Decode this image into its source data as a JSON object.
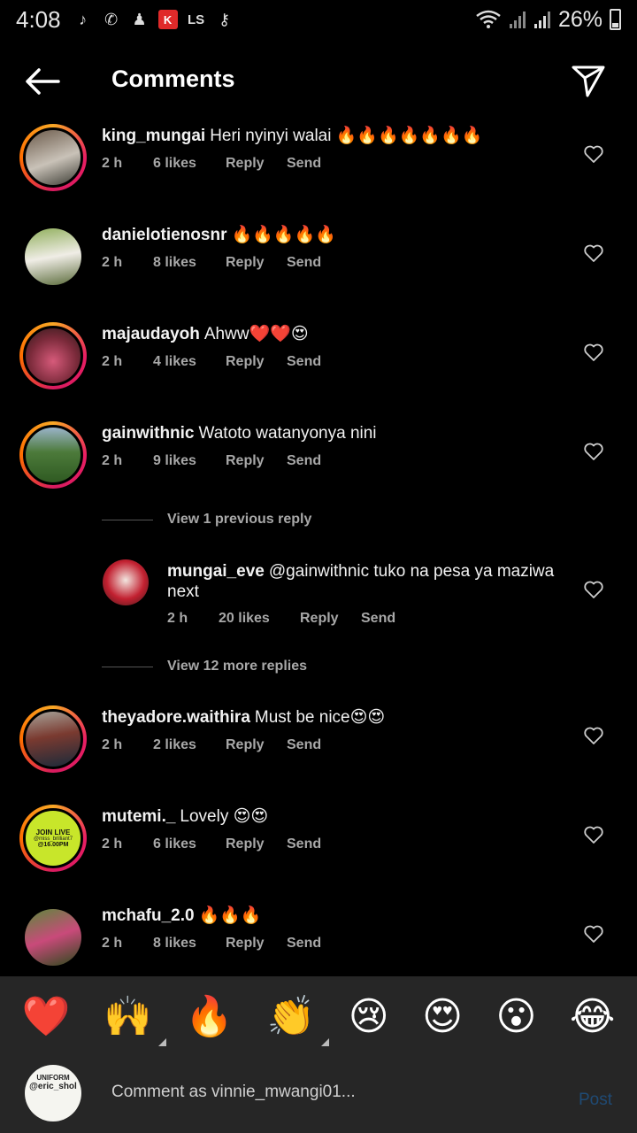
{
  "status": {
    "time": "4:08",
    "battery": "26%"
  },
  "header": {
    "title": "Comments"
  },
  "comments": [
    {
      "user": "king_mungai",
      "text": "Heri nyinyi walai 🔥🔥🔥🔥🔥🔥🔥",
      "time": "2 h",
      "likes": "6 likes",
      "reply": "Reply",
      "send": "Send"
    },
    {
      "user": "danielotienosnr",
      "text": "🔥🔥🔥🔥🔥",
      "time": "2 h",
      "likes": "8 likes",
      "reply": "Reply",
      "send": "Send"
    },
    {
      "user": "majaudayoh",
      "text": "Ahww❤️❤️😍",
      "time": "2 h",
      "likes": "4 likes",
      "reply": "Reply",
      "send": "Send"
    },
    {
      "user": "gainwithnic",
      "text": "Watoto watanyonya nini",
      "time": "2 h",
      "likes": "9 likes",
      "reply": "Reply",
      "send": "Send"
    },
    {
      "user": "theyadore.waithira",
      "text": "Must be nice😍😍",
      "time": "2 h",
      "likes": "2 likes",
      "reply": "Reply",
      "send": "Send"
    },
    {
      "user": "mutemi._",
      "text": "Lovely 😍😍",
      "time": "2 h",
      "likes": "6 likes",
      "reply": "Reply",
      "send": "Send"
    },
    {
      "user": "mchafu_2.0",
      "text": "🔥🔥🔥",
      "time": "2 h",
      "likes": "8 likes",
      "reply": "Reply",
      "send": "Send"
    }
  ],
  "thread": {
    "view_previous": "View 1 previous reply",
    "view_more": "View 12 more replies",
    "reply": {
      "user": "mungai_eve",
      "text": "@gainwithnic tuko na pesa ya maziwa next",
      "time": "2 h",
      "likes": "20 likes",
      "reply": "Reply",
      "send": "Send"
    }
  },
  "mutemi_avatar": {
    "line1": "JOIN LIVE",
    "line2": "@miss_brilliant7",
    "line3": "@16.00PM"
  },
  "emoji_bar": [
    "❤️",
    "🙌",
    "🔥",
    "👏",
    "😢",
    "😍",
    "😮",
    "😂"
  ],
  "composer": {
    "placeholder": "Comment as vinnie_mwangi01...",
    "post": "Post",
    "avatar_line1": "UNIFORM",
    "avatar_line2": "@eric_shol"
  },
  "colors": {
    "background": "#000000",
    "secondary_text": "#a8a8a8",
    "bar_bg": "#262626",
    "post_disabled": "#1f4a74"
  }
}
